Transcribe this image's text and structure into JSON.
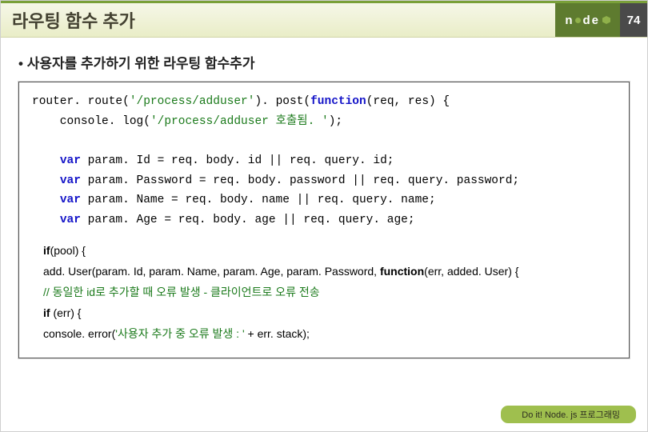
{
  "header": {
    "title": "라우팅 함수 추가",
    "logo_left": "n",
    "logo_right": "de",
    "page_number": "74"
  },
  "bullet": "사용자를 추가하기 위한 라우팅 함수추가",
  "code": {
    "l1a": "router. route(",
    "l1s": "'/process/adduser'",
    "l1b": "). post(",
    "l1fn": "function",
    "l1c": "(req, res) {",
    "l2a": "    console. log(",
    "l2s": "'/process/adduser 호출됨. '",
    "l2b": ");",
    "var": "var",
    "l3": " param. Id = req. body. id || req. query. id;",
    "l4": " param. Password = req. body. password || req. query. password;",
    "l5": " param. Name = req. body. name || req. query. name;",
    "l6": " param. Age = req. body. age || req. query. age;"
  },
  "body2": {
    "if": "if",
    "l1": "(pool) {",
    "l2a": "  add. User(param. Id, param. Name, param. Age, param. Password, ",
    "fn": "function",
    "l2b": "(err, added. User) {",
    "cmt": "  // 동일한 id로 추가할 때 오류 발생 - 클라이언트로 오류 전송",
    "l4a": "  ",
    "l4b": " (err) {",
    "l5a": "    console. error(",
    "l5s": "'사용자 추가 중 오류 발생 : '",
    "l5b": " + err. stack);"
  },
  "footer": "Do it! Node. js 프로그래밍"
}
